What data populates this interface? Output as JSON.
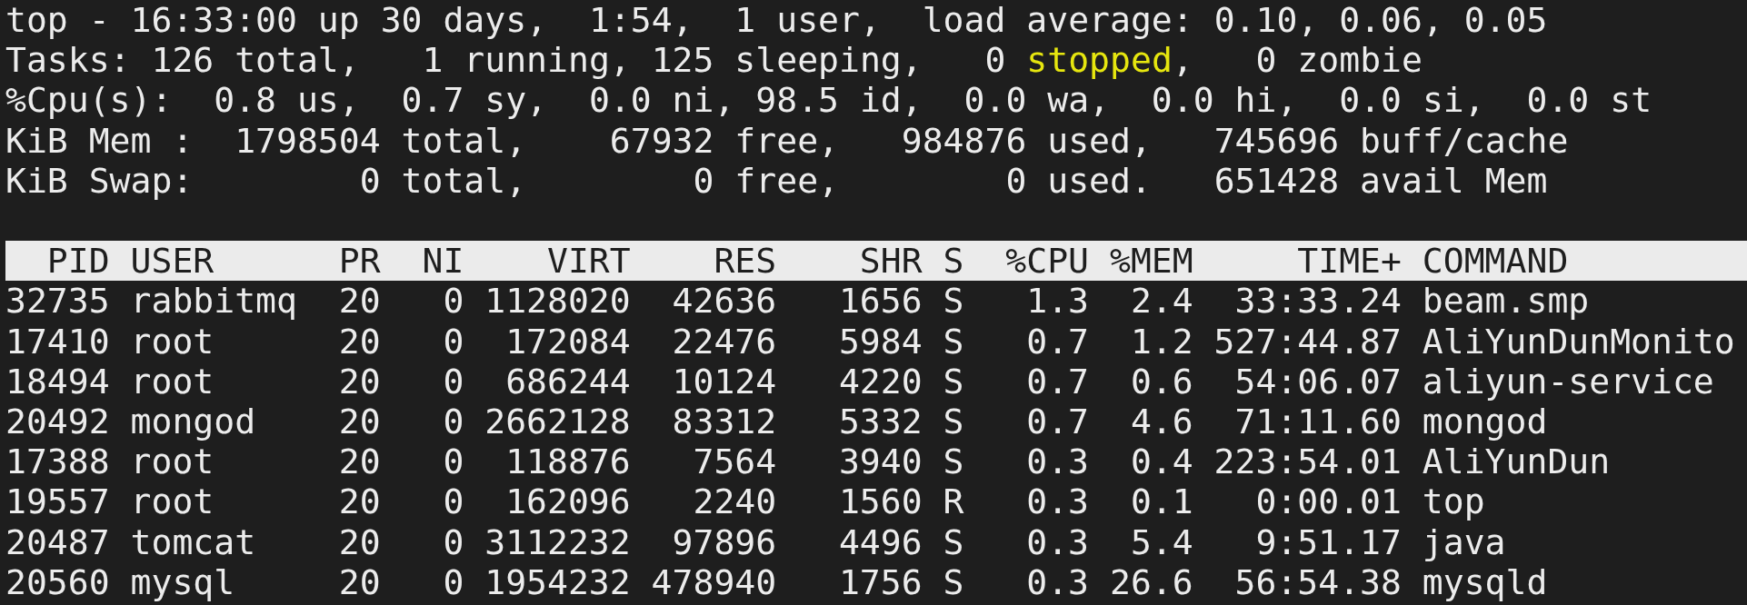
{
  "summary": [
    {
      "segments": [
        {
          "text": "top - 16:33:00 up 30 days,  1:54,  1 user,  load average: 0.10, 0.06, 0.05",
          "highlighted": false
        }
      ]
    },
    {
      "segments": [
        {
          "text": "Tasks: 126 total,   1 running, 125 sleeping,   0 ",
          "highlighted": false
        },
        {
          "text": "stopped",
          "highlighted": true
        },
        {
          "text": ",   0 zombie",
          "highlighted": false
        }
      ]
    },
    {
      "segments": [
        {
          "text": "%Cpu(s):  0.8 us,  0.7 sy,  0.0 ni, 98.5 id,  0.0 wa,  0.0 hi,  0.0 si,  0.0 st",
          "highlighted": false
        }
      ]
    },
    {
      "segments": [
        {
          "text": "KiB Mem :  1798504 total,    67932 free,   984876 used,   745696 buff/cache",
          "highlighted": false
        }
      ]
    },
    {
      "segments": [
        {
          "text": "KiB Swap:        0 total,        0 free,        0 used.   651428 avail Mem",
          "highlighted": false
        }
      ]
    }
  ],
  "table": {
    "columns": [
      "PID",
      "USER",
      "PR",
      "NI",
      "VIRT",
      "RES",
      "SHR",
      "S",
      "%CPU",
      "%MEM",
      "TIME+",
      "COMMAND"
    ],
    "rows": [
      [
        "32735",
        "rabbitmq",
        "20",
        "0",
        "1128020",
        "42636",
        "1656",
        "S",
        "1.3",
        "2.4",
        "33:33.24",
        "beam.smp"
      ],
      [
        "17410",
        "root",
        "20",
        "0",
        "172084",
        "22476",
        "5984",
        "S",
        "0.7",
        "1.2",
        "527:44.87",
        "AliYunDunMonito"
      ],
      [
        "18494",
        "root",
        "20",
        "0",
        "686244",
        "10124",
        "4220",
        "S",
        "0.7",
        "0.6",
        "54:06.07",
        "aliyun-service"
      ],
      [
        "20492",
        "mongod",
        "20",
        "0",
        "2662128",
        "83312",
        "5332",
        "S",
        "0.7",
        "4.6",
        "71:11.60",
        "mongod"
      ],
      [
        "17388",
        "root",
        "20",
        "0",
        "118876",
        "7564",
        "3940",
        "S",
        "0.3",
        "0.4",
        "223:54.01",
        "AliYunDun"
      ],
      [
        "19557",
        "root",
        "20",
        "0",
        "162096",
        "2240",
        "1560",
        "R",
        "0.3",
        "0.1",
        "0:00.01",
        "top"
      ],
      [
        "20487",
        "tomcat",
        "20",
        "0",
        "3112232",
        "97896",
        "4496",
        "S",
        "0.3",
        "5.4",
        "9:51.17",
        "java"
      ],
      [
        "20560",
        "mysql",
        "20",
        "0",
        "1954232",
        "478940",
        "1756",
        "S",
        "0.3",
        "26.6",
        "56:54.38",
        "mysqld"
      ]
    ]
  }
}
